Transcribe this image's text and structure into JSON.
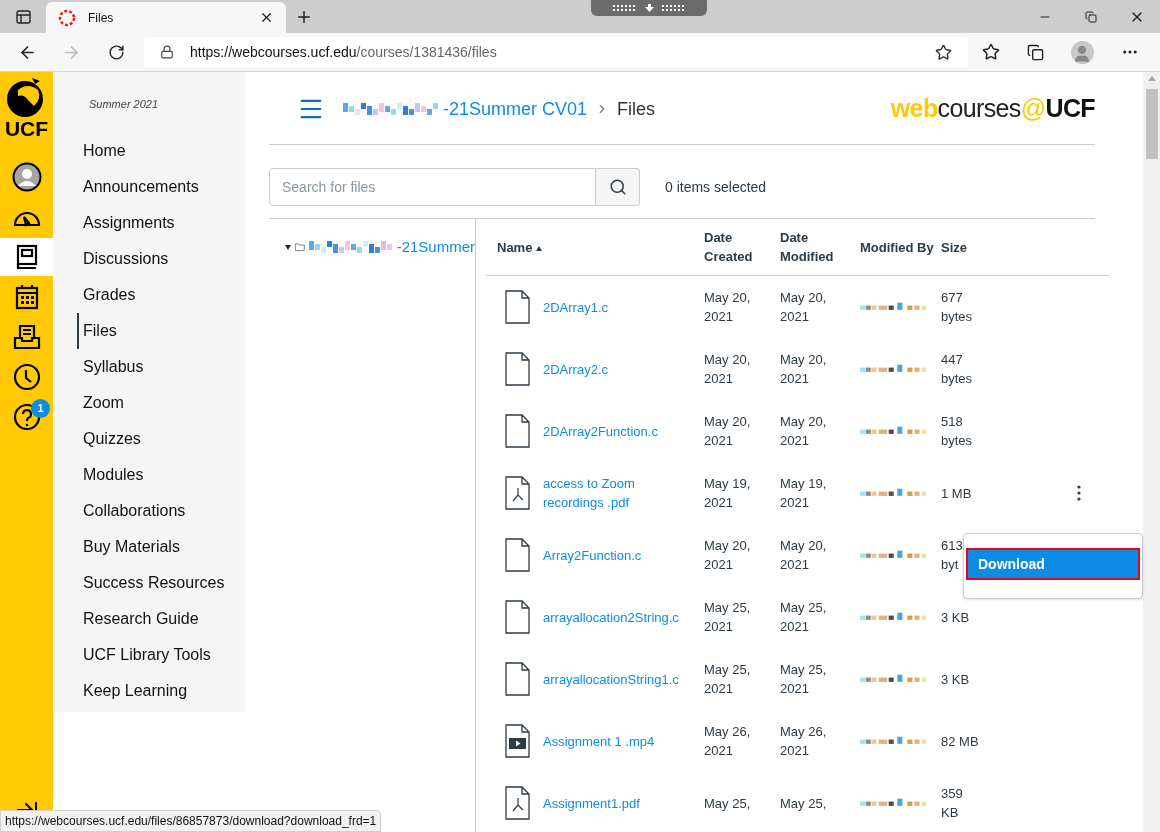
{
  "browser": {
    "tab_title": "Files",
    "url_host": "https://webcourses.ucf.edu",
    "url_path": "/courses/1381436/files",
    "status_url": "https://webcourses.ucf.edu/files/86857873/download?download_frd=1"
  },
  "global_nav": {
    "logo_text": "UCF",
    "items": [
      {
        "kind": "account",
        "selected": false
      },
      {
        "kind": "dashboard",
        "selected": false
      },
      {
        "kind": "courses",
        "selected": true
      },
      {
        "kind": "calendar",
        "selected": false
      },
      {
        "kind": "inbox",
        "selected": false
      },
      {
        "kind": "history",
        "selected": false
      },
      {
        "kind": "help",
        "selected": false,
        "badge": "1"
      }
    ]
  },
  "course_nav": {
    "term": "Summer 2021",
    "items": [
      {
        "label": "Home",
        "selected": false
      },
      {
        "label": "Announcements",
        "selected": false
      },
      {
        "label": "Assignments",
        "selected": false
      },
      {
        "label": "Discussions",
        "selected": false
      },
      {
        "label": "Grades",
        "selected": false
      },
      {
        "label": "Files",
        "selected": true
      },
      {
        "label": "Syllabus",
        "selected": false
      },
      {
        "label": "Zoom",
        "selected": false
      },
      {
        "label": "Quizzes",
        "selected": false
      },
      {
        "label": "Modules",
        "selected": false
      },
      {
        "label": "Collaborations",
        "selected": false
      },
      {
        "label": "Buy Materials",
        "selected": false
      },
      {
        "label": "Success Resources",
        "selected": false
      },
      {
        "label": "Research Guide",
        "selected": false
      },
      {
        "label": "UCF Library Tools",
        "selected": false
      },
      {
        "label": "Keep Learning",
        "selected": false
      }
    ]
  },
  "header": {
    "breadcrumb": [
      {
        "label": "-21Summer CV01",
        "kind": "link"
      },
      {
        "label": "Files",
        "kind": "current"
      }
    ],
    "logo": {
      "web": "web",
      "courses": "courses",
      "at": "@",
      "ucf": "UCF"
    }
  },
  "search": {
    "placeholder": "Search for files"
  },
  "selection_count": "0 items selected",
  "tree": {
    "label": "-21Summer",
    "expanded": true
  },
  "table": {
    "columns": [
      {
        "label": "Name",
        "sorted": true
      },
      {
        "label": "Date Created",
        "sorted": false
      },
      {
        "label": "Date Modified",
        "sorted": false
      },
      {
        "label": "Modified By",
        "sorted": false
      },
      {
        "label": "Size",
        "sorted": false
      }
    ],
    "rows": [
      {
        "kind": "file",
        "name": "2DArray1.c",
        "created": "May 20, 2021",
        "modified": "May 20, 2021",
        "size": "677 bytes",
        "actions_visible": false
      },
      {
        "kind": "file",
        "name": "2DArray2.c",
        "created": "May 20, 2021",
        "modified": "May 20, 2021",
        "size": "447 bytes",
        "actions_visible": false
      },
      {
        "kind": "file",
        "name": "2DArray2Function.c",
        "created": "May 20, 2021",
        "modified": "May 20, 2021",
        "size": "518 bytes",
        "actions_visible": false
      },
      {
        "kind": "pdf",
        "name": "access to Zoom recordings .pdf",
        "created": "May 19, 2021",
        "modified": "May 19, 2021",
        "size": "1 MB",
        "actions_visible": true
      },
      {
        "kind": "file",
        "name": "Array2Function.c",
        "created": "May 20, 2021",
        "modified": "May 20, 2021",
        "size": "613 byt",
        "actions_visible": false
      },
      {
        "kind": "file",
        "name": "arrayallocation2String.c",
        "created": "May 25, 2021",
        "modified": "May 25, 2021",
        "size": "3 KB",
        "actions_visible": false
      },
      {
        "kind": "file",
        "name": "arrayallocationString1.c",
        "created": "May 25, 2021",
        "modified": "May 25, 2021",
        "size": "3 KB",
        "actions_visible": false
      },
      {
        "kind": "video",
        "name": "Assignment 1 .mp4",
        "created": "May 26, 2021",
        "modified": "May 26, 2021",
        "size": "82 MB",
        "actions_visible": false
      },
      {
        "kind": "pdf",
        "name": "Assignment1.pdf",
        "created": "May 25,",
        "modified": "May 25,",
        "size": "359 KB",
        "actions_visible": false
      }
    ]
  },
  "menu": {
    "items": [
      {
        "label": "Download",
        "selected": true
      }
    ]
  }
}
